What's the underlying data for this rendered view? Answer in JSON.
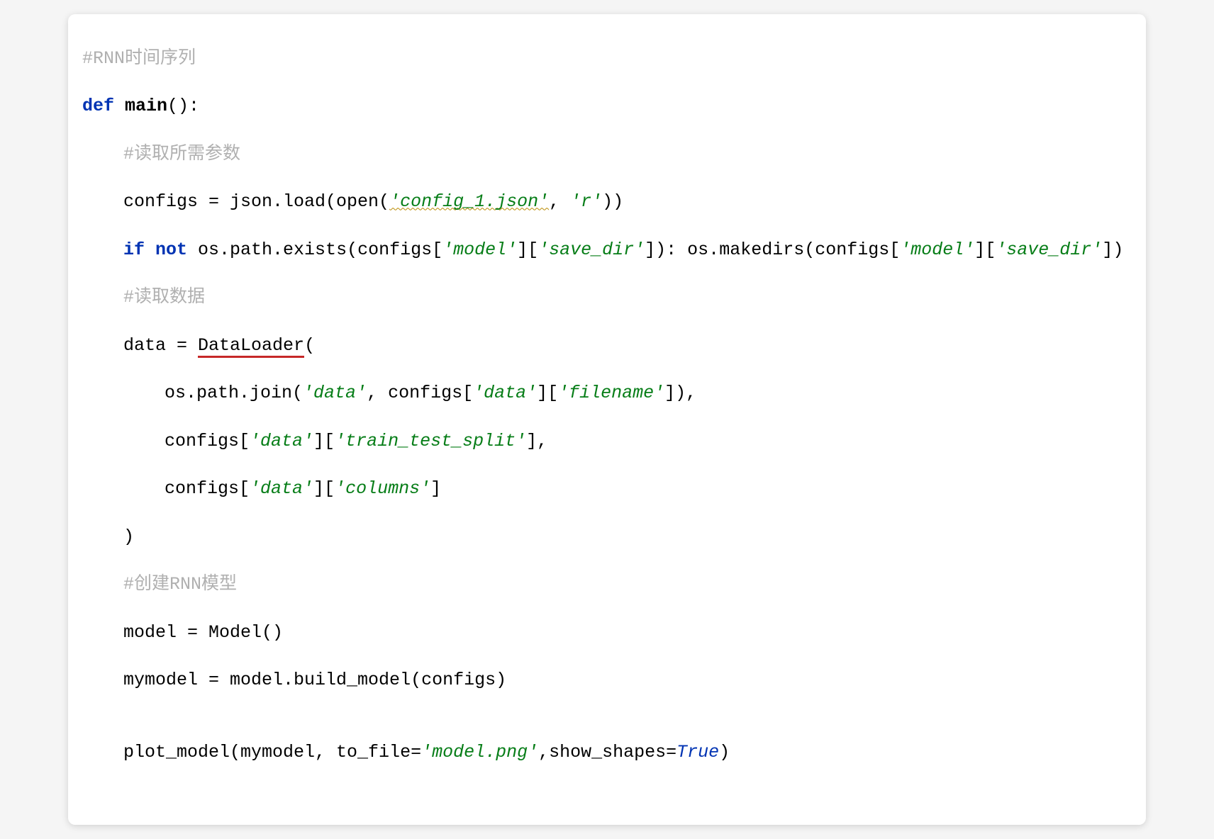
{
  "code": {
    "line1_comment": "#RNN时间序列",
    "line2": {
      "kw_def": "def ",
      "funcname": "main",
      "rest": "():"
    },
    "line3_comment": "#读取所需参数",
    "line4": {
      "p1": "configs = json.load(open(",
      "s1": "'config_1.json'",
      "p2": ", ",
      "s2": "'r'",
      "p3": "))"
    },
    "line5": {
      "kw_if": "if ",
      "kw_not": "not ",
      "p1": "os.path.exists(configs[",
      "s1": "'model'",
      "p2": "][",
      "s2": "'save_dir'",
      "p3": "]): os.makedirs(configs[",
      "s3": "'model'",
      "p4": "][",
      "s4": "'save_dir'",
      "p5": "])"
    },
    "line6_comment": "#读取数据",
    "line7": {
      "p1": "data = ",
      "cls": "DataLoader",
      "p2": "("
    },
    "line8": {
      "p1": "os.path.join(",
      "s1": "'data'",
      "p2": ", configs[",
      "s2": "'data'",
      "p3": "][",
      "s3": "'filename'",
      "p4": "]),"
    },
    "line9": {
      "p1": "configs[",
      "s1": "'data'",
      "p2": "][",
      "s2": "'train_test_split'",
      "p3": "],"
    },
    "line10": {
      "p1": "configs[",
      "s1": "'data'",
      "p2": "][",
      "s2": "'columns'",
      "p3": "]"
    },
    "line11": ")",
    "line12_comment": "#创建RNN模型",
    "line13": "model = Model()",
    "line14": "mymodel = model.build_model(configs)",
    "line15_blank": "",
    "line16": {
      "p1": "plot_model(mymodel, to_file=",
      "s1": "'model.png'",
      "p2": ",show_shapes=",
      "v1": "True",
      "p3": ")"
    }
  }
}
